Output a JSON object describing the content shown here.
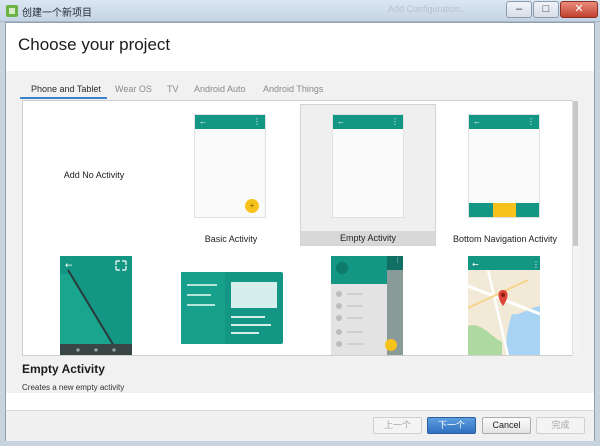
{
  "window": {
    "title": "创建一个新项目",
    "background_title": "Add Configuration..."
  },
  "page": {
    "title": "Choose your project"
  },
  "tabs": [
    {
      "label": "Phone and Tablet",
      "active": true
    },
    {
      "label": "Wear OS",
      "active": false
    },
    {
      "label": "TV",
      "active": false
    },
    {
      "label": "Android Auto",
      "active": false
    },
    {
      "label": "Android Things",
      "active": false
    }
  ],
  "templates": [
    {
      "label": "Add No Activity",
      "selected": false,
      "icon": "none"
    },
    {
      "label": "Basic Activity",
      "selected": false,
      "icon": "basic-activity-preview"
    },
    {
      "label": "Empty Activity",
      "selected": true,
      "icon": "empty-activity-preview"
    },
    {
      "label": "Bottom Navigation Activity",
      "selected": false,
      "icon": "bottom-navigation-preview"
    },
    {
      "label": "",
      "selected": false,
      "icon": "fullscreen-activity-preview"
    },
    {
      "label": "",
      "selected": false,
      "icon": "master-detail-preview"
    },
    {
      "label": "",
      "selected": false,
      "icon": "navigation-drawer-preview"
    },
    {
      "label": "",
      "selected": false,
      "icon": "google-maps-preview"
    }
  ],
  "selection": {
    "title": "Empty Activity",
    "description": "Creates a new empty activity"
  },
  "buttons": {
    "previous": "上一个",
    "next": "下一个",
    "cancel": "Cancel",
    "finish": "完成"
  },
  "colors": {
    "teal": "#139683",
    "accent": "#f7c21b",
    "selection": "#d8d8d8",
    "primary_button": "#3a7fcc"
  }
}
